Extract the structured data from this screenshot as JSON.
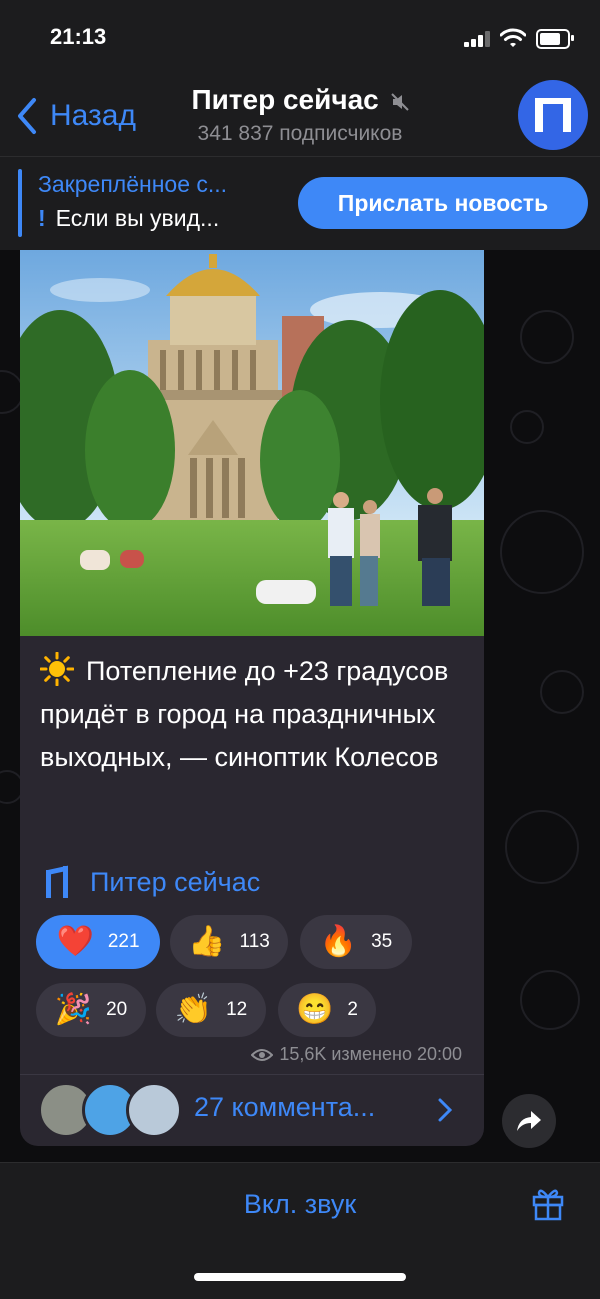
{
  "status": {
    "time": "21:13"
  },
  "header": {
    "back_label": "Назад",
    "title": "Питер сейчас",
    "subtitle": "341 837 подписчиков",
    "icons": [
      "back-chevron-icon",
      "muted-speaker-icon",
      "channel-avatar"
    ]
  },
  "pinned": {
    "title": "Закреплённое с...",
    "text": "Если вы увид...",
    "send_button": "Прислать новость"
  },
  "message": {
    "text": "Потепление до +23 градусов придёт в город на праздничных выходных, — синоптик Колесов",
    "signature": "Питер сейчас",
    "reactions": [
      {
        "emoji": "❤️",
        "count": "221",
        "active": true
      },
      {
        "emoji": "👍",
        "count": "113",
        "active": false
      },
      {
        "emoji": "🔥",
        "count": "35",
        "active": false
      },
      {
        "emoji": "🎉",
        "count": "20",
        "active": false
      },
      {
        "emoji": "👏",
        "count": "12",
        "active": false
      },
      {
        "emoji": "😁",
        "count": "2",
        "active": false
      }
    ],
    "meta": "15,6K изменено 20:00",
    "comments_label": "27 коммента..."
  },
  "bottom": {
    "unmute_label": "Вкл. звук"
  },
  "colors": {
    "accent": "#3e88f7",
    "bubble": "#2a2730",
    "bar": "#1c1c1e",
    "reaction_bg": "#3a3742"
  }
}
